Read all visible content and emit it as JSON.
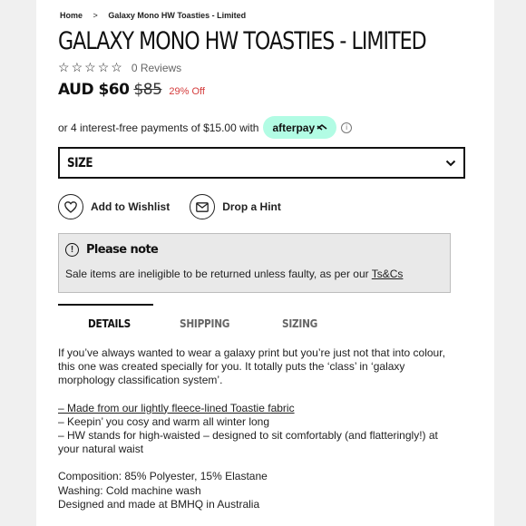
{
  "breadcrumb": {
    "home": "Home",
    "separator": ">",
    "current": "Galaxy Mono HW Toasties - Limited"
  },
  "product": {
    "title": "GALAXY MONO HW TOASTIES - LIMITED",
    "rating": {
      "stars": 0,
      "max_stars": 5,
      "reviews_label": "0 Reviews"
    },
    "price": {
      "now": "AUD $60",
      "was": "$85",
      "discount": "29% Off",
      "discount_color": "#d43b3b"
    },
    "afterpay": {
      "text": "or 4 interest-free payments of $15.00 with",
      "badge": "afterpay",
      "badge_color": "#b2fce4"
    }
  },
  "size_select": {
    "label": "SIZE",
    "icon": "chevron-down-icon"
  },
  "actions": {
    "wishlist": {
      "label": "Add to Wishlist",
      "icon": "heart-icon"
    },
    "hint": {
      "label": "Drop a Hint",
      "icon": "mail-icon"
    }
  },
  "note": {
    "title": "Please note",
    "text": "Sale items are ineligible to be returned unless faulty, as per our",
    "link": "Ts&Cs"
  },
  "tabs": [
    {
      "label": "DETAILS",
      "active": true
    },
    {
      "label": "SHIPPING",
      "active": false
    },
    {
      "label": "SIZING",
      "active": false
    }
  ],
  "description": {
    "intro": "If you’ve always wanted to wear a galaxy print but you’re just not that into colour, this one was created specially for you. It totally puts the ‘class’ in ‘galaxy morphology classification system’.",
    "bullet_1": "– Made from our lightly fleece-lined Toastie fabric",
    "bullet_2": "– Keepin’ you cosy and warm all winter long",
    "bullet_3": "– HW stands for high-waisted – designed to sit comfortably (and flatteringly!) at your natural waist",
    "composition": "Composition: 85% Polyester, 15% Elastane",
    "washing": "Washing: Cold machine wash",
    "made": "Designed and made at BMHQ in Australia"
  }
}
